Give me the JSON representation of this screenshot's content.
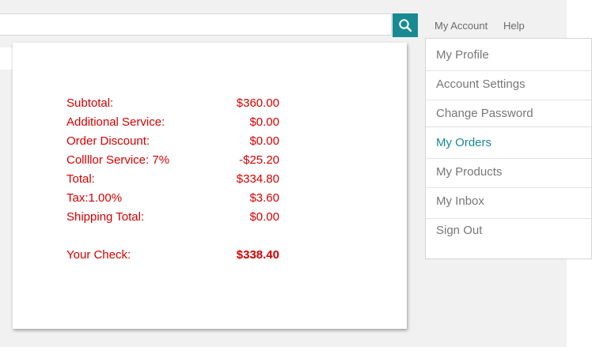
{
  "search": {
    "placeholder": ""
  },
  "topnav": {
    "my_account": "My Account",
    "help": "Help"
  },
  "account_menu": {
    "items": [
      {
        "label": "My Profile",
        "active": false
      },
      {
        "label": "Account Settings",
        "active": false
      },
      {
        "label": "Change Password",
        "active": false
      },
      {
        "label": "My Orders",
        "active": true
      },
      {
        "label": "My Products",
        "active": false
      },
      {
        "label": "My Inbox",
        "active": false
      },
      {
        "label": "Sign Out",
        "active": false
      }
    ]
  },
  "summary": {
    "rows": [
      {
        "label": "Subtotal:",
        "value": "$360.00"
      },
      {
        "label": "Additional Service:",
        "value": "$0.00"
      },
      {
        "label": "Order Discount:",
        "value": "$0.00"
      },
      {
        "label": "Collllor Service: 7%",
        "value": "-$25.20"
      },
      {
        "label": "Total:",
        "value": "$334.80"
      },
      {
        "label": "Tax:1.00%",
        "value": "$3.60"
      },
      {
        "label": "Shipping Total:",
        "value": "$0.00"
      }
    ],
    "check_label": "Your Check:",
    "check_value": "$338.40"
  },
  "colors": {
    "accent": "#198a92",
    "summary_text": "#d40000",
    "menu_text": "#777777"
  },
  "icons": {
    "search_button": "search-icon"
  }
}
